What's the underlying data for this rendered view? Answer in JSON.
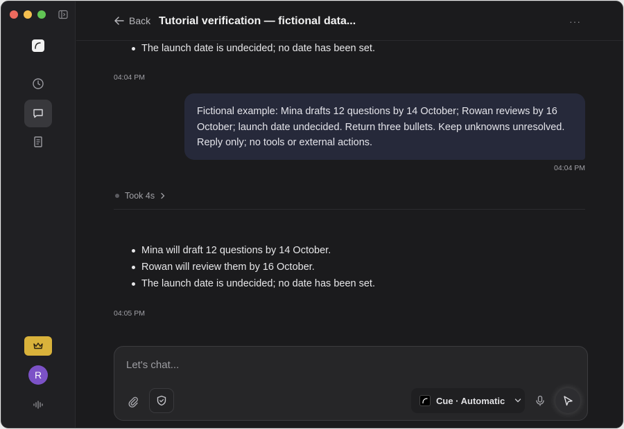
{
  "header": {
    "back_label": "Back",
    "title": "Tutorial verification — fictional data...",
    "more_label": "···"
  },
  "sidebar": {
    "avatar_initial": "R"
  },
  "messages": {
    "prev_tail": "The launch date is undecided; no date has been set.",
    "prev_time": "04:04 PM",
    "user_text": "Fictional example: Mina drafts 12 questions by 14 October; Rowan reviews by 16 October; launch date undecided. Return three bullets. Keep unknowns unresolved. Reply only; no tools or external actions.",
    "user_time": "04:04 PM",
    "took_label": "Took 4s",
    "reply_bullets": [
      "Mina will draft 12 questions by 14 October.",
      "Rowan will review them by 16 October.",
      "The launch date is undecided; no date has been set."
    ],
    "reply_time": "04:05 PM"
  },
  "composer": {
    "placeholder": "Let's chat...",
    "model_label": "Cue · Automatic"
  },
  "colors": {
    "accent_upgrade": "#d9b23b",
    "avatar": "#7c52c7",
    "user_bubble": "#26293a"
  }
}
